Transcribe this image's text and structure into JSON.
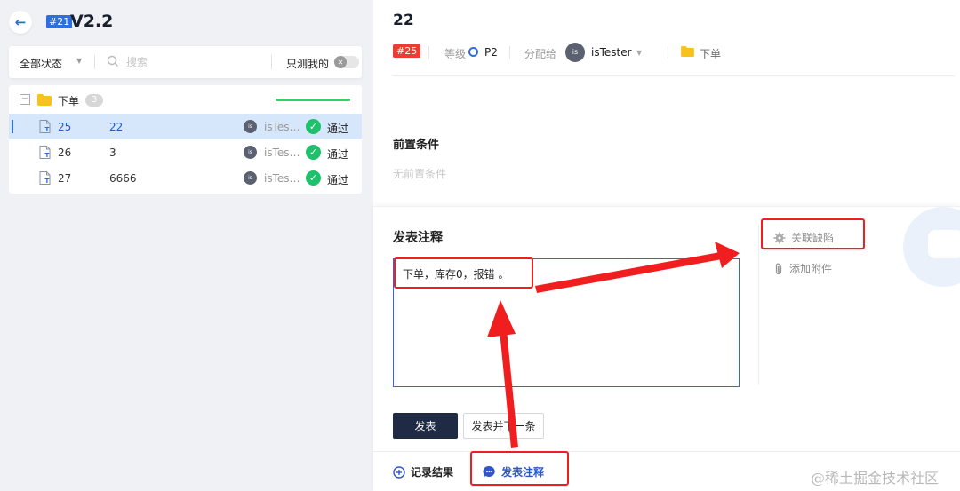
{
  "left": {
    "version_badge": "#21",
    "version_title": "V2.2",
    "filter": {
      "status_label": "全部状态",
      "search_placeholder": "搜索",
      "only_mine_label": "只测我的"
    },
    "tree": {
      "folder_name": "下单",
      "folder_count": "3",
      "progress": 1.0,
      "cases": [
        {
          "id": "25",
          "title": "22",
          "user": "isTester",
          "avatar": "is",
          "result": "通过",
          "selected": true
        },
        {
          "id": "26",
          "title": "3",
          "user": "isTester",
          "avatar": "is",
          "result": "通过",
          "selected": false
        },
        {
          "id": "27",
          "title": "6666",
          "user": "isTester",
          "avatar": "is",
          "result": "通过",
          "selected": false
        }
      ]
    }
  },
  "right": {
    "case_title": "22",
    "case_id_tag": "#25",
    "priority_label": "等级",
    "priority_value": "P2",
    "assign_label": "分配给",
    "assignee_avatar": "is",
    "assignee": "isTester",
    "module": "下单",
    "precondition_title": "前置条件",
    "precondition_empty": "无前置条件",
    "comment_title": "发表注释",
    "comment_value": "下单，库存0，报错 。",
    "link_defect": "关联缺陷",
    "add_attachment": "添加附件",
    "submit_label": "发表",
    "submit_next_label": "发表并下一条",
    "tab_record": "记录结果",
    "tab_comment": "发表注释",
    "watermark": "@稀土掘金技术社区"
  },
  "colors": {
    "accent": "#2e6fe0",
    "danger_tag": "#ee3c32",
    "pass": "#1fc06b",
    "primary_button": "#1f2a44",
    "annotation": "#f01e1e"
  }
}
